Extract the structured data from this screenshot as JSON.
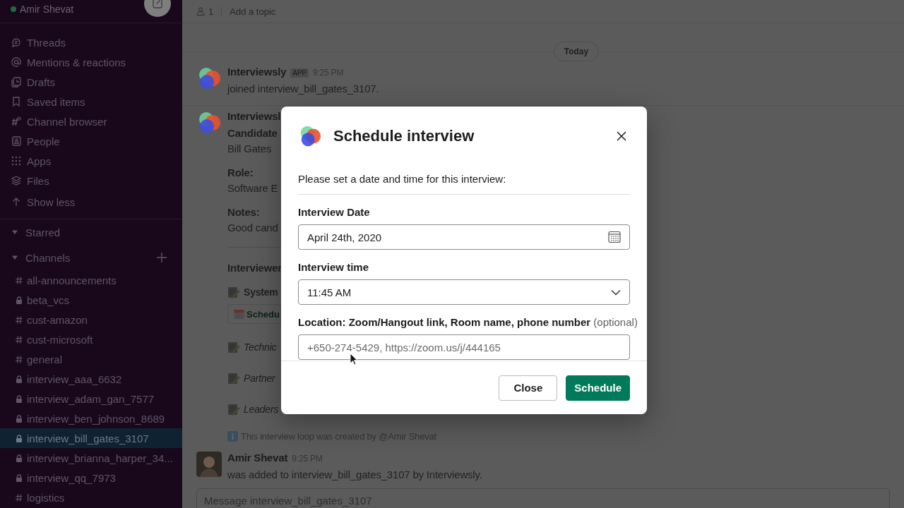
{
  "sidebar": {
    "user": {
      "name": "Amir Shevat",
      "active": true
    },
    "nav_items": [
      {
        "label": "Threads"
      },
      {
        "label": "Mentions & reactions"
      },
      {
        "label": "Drafts"
      },
      {
        "label": "Saved items"
      },
      {
        "label": "Channel browser"
      },
      {
        "label": "People"
      },
      {
        "label": "Apps"
      },
      {
        "label": "Files"
      },
      {
        "label": "Show less"
      }
    ],
    "sections": [
      {
        "label": "Starred",
        "expanded": true
      },
      {
        "label": "Channels",
        "expanded": true,
        "channels": [
          {
            "name": "all-announcements",
            "private": false,
            "selected": false
          },
          {
            "name": "beta_vcs",
            "private": true,
            "selected": false
          },
          {
            "name": "cust-amazon",
            "private": false,
            "selected": false
          },
          {
            "name": "cust-microsoft",
            "private": false,
            "selected": false
          },
          {
            "name": "general",
            "private": false,
            "selected": false
          },
          {
            "name": "interview_aaa_6632",
            "private": true,
            "selected": false
          },
          {
            "name": "interview_adam_gan_7577",
            "private": true,
            "selected": false
          },
          {
            "name": "interview_ben_johnson_8689",
            "private": true,
            "selected": false
          },
          {
            "name": "interview_bill_gates_3107",
            "private": true,
            "selected": true
          },
          {
            "name": "interview_brianna_harper_34...",
            "private": true,
            "selected": false
          },
          {
            "name": "interview_qq_7973",
            "private": true,
            "selected": false
          },
          {
            "name": "logistics",
            "private": false,
            "selected": false
          }
        ]
      }
    ]
  },
  "header": {
    "member_count": "1",
    "topic": "Add a topic"
  },
  "date_divider": "Today",
  "messages": [
    {
      "kind": "app",
      "author": "Interviewsly",
      "badge": "APP",
      "time": "9:25 PM",
      "text": "joined interview_bill_gates_3107."
    },
    {
      "kind": "loop",
      "author": "Interviewsl",
      "fields": [
        {
          "label": "Candidate",
          "value": "Bill Gates"
        },
        {
          "label": "Role:",
          "value": "Software E"
        },
        {
          "label": "Notes:",
          "value": "Good cand"
        }
      ],
      "section_title": "Interviewer",
      "interviews": [
        {
          "title": "System",
          "italic": false,
          "button": "Schedu"
        },
        {
          "title": "Technic",
          "italic": true
        },
        {
          "title": "Partner",
          "italic": true
        },
        {
          "title": "Leaders",
          "italic": true
        }
      ],
      "footer": "This interview loop was created by @Amir Shevat"
    },
    {
      "kind": "user",
      "author": "Amir Shevat",
      "time": "9:25 PM",
      "text": "was added to interview_bill_gates_3107 by Interviewsly."
    }
  ],
  "composer": {
    "placeholder": "Message interview_bill_gates_3107"
  },
  "modal": {
    "title": "Schedule interview",
    "intro": "Please set a date and time for this interview:",
    "fields": [
      {
        "kind": "date",
        "label": "Interview Date",
        "value": "April 24th, 2020"
      },
      {
        "kind": "select",
        "label": "Interview time",
        "value": "11:45 AM"
      },
      {
        "kind": "text",
        "label": "Location: Zoom/Hangout link, Room name, phone number",
        "hint": "(optional)",
        "placeholder": "+650-274-5429, https://zoom.us/j/444165"
      }
    ],
    "buttons": [
      {
        "label": "Close",
        "kind": "secondary"
      },
      {
        "label": "Schedule",
        "kind": "primary"
      }
    ]
  }
}
